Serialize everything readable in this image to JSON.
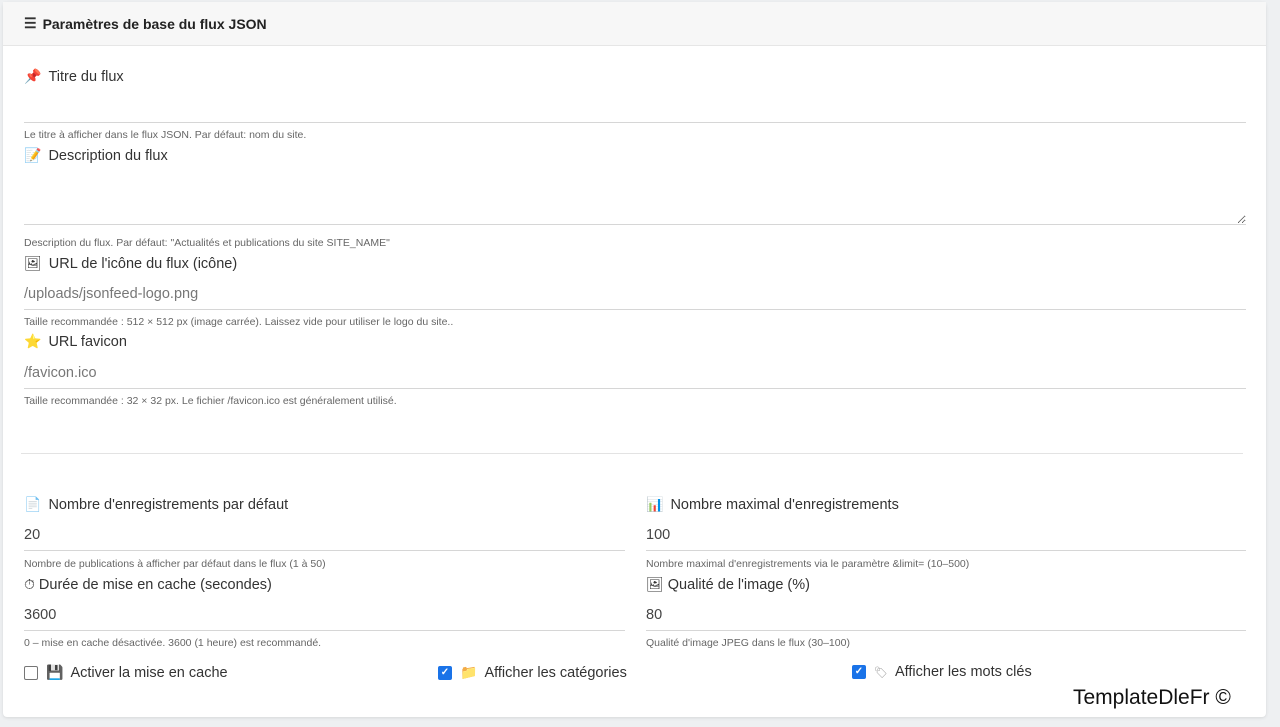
{
  "header": {
    "title": "Paramètres de base du flux JSON",
    "icon": "sliders-icon"
  },
  "fields": {
    "feed_title": {
      "icon": "pushpin-icon",
      "label": "Titre du flux",
      "value": "",
      "hint": "Le titre à afficher dans le flux JSON. Par défaut: nom du site."
    },
    "feed_description": {
      "icon": "memo-icon",
      "label": "Description du flux",
      "value": "",
      "hint": "Description du flux. Par défaut: \"Actualités et publications du site SITE_NAME\""
    },
    "feed_icon_url": {
      "icon": "picture-icon",
      "label": "URL de l'icône du flux (icône)",
      "placeholder": "/uploads/jsonfeed-logo.png",
      "hint": "Taille recommandée : 512 × 512 px (image carrée). Laissez vide pour utiliser le logo du site.."
    },
    "favicon_url": {
      "icon": "star-icon",
      "label": "URL favicon",
      "placeholder": "/favicon.ico",
      "hint": "Taille recommandée : 32 × 32 px. Le fichier /favicon.ico est généralement utilisé."
    },
    "default_records": {
      "icon": "page-icon",
      "label": "Nombre d'enregistrements par défaut",
      "value": "20",
      "hint": "Nombre de publications à afficher par défaut dans le flux (1 à 50)"
    },
    "max_records": {
      "icon": "bar-chart-icon",
      "label": "Nombre maximal d'enregistrements",
      "value": "100",
      "hint": "Nombre maximal d'enregistrements via le paramètre &limit= (10–500)"
    },
    "cache_duration": {
      "icon": "stopwatch-icon",
      "label": "Durée de mise en cache (secondes)",
      "value": "3600",
      "hint": "0 – mise en cache désactivée. 3600 (1 heure) est recommandé."
    },
    "image_quality": {
      "icon": "picture-icon",
      "label": "Qualité de l'image (%)",
      "value": "80",
      "hint": "Qualité d'image JPEG dans le flux (30–100)"
    }
  },
  "checkboxes": {
    "enable_cache": {
      "icon": "floppy-disk-icon",
      "label": "Activer la mise en cache",
      "checked": false
    },
    "show_categories": {
      "icon": "folder-icon",
      "label": "Afficher les catégories",
      "checked": true
    },
    "show_keywords": {
      "icon": "label-tag-icon",
      "label": "Afficher les mots clés",
      "checked": true
    }
  },
  "watermark": "TemplateDleFr ©",
  "colors": {
    "accent": "#1a73e8",
    "header_bg": "#f7f7f7",
    "page_bg": "#eef0f2"
  }
}
